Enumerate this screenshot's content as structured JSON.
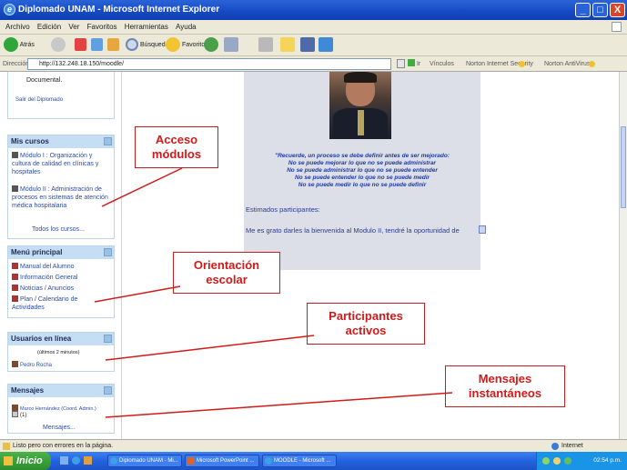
{
  "window": {
    "title": "Diplomado UNAM - Microsoft Internet Explorer",
    "minimize": "_",
    "maximize": "□",
    "close": "X"
  },
  "menubar": [
    "Archivo",
    "Edición",
    "Ver",
    "Favoritos",
    "Herramientas",
    "Ayuda"
  ],
  "toolbar": {
    "back_label": "Atrás",
    "search_label": "Búsqueda",
    "favorites_label": "Favoritos"
  },
  "address": {
    "label": "Dirección",
    "url": "http://132.248.18.150/moodle/",
    "go_label": "Ir",
    "vinculos": "Vínculos",
    "norton_security": "Norton Internet Security",
    "norton_antivirus": "Norton AntiVirus"
  },
  "sidebar": {
    "documental": "Documental.",
    "salir": "Salir del Diplomado",
    "mis_cursos": {
      "title": "Mis cursos",
      "items": [
        "Módulo I : Organización y cultura de calidad en clínicas y hospitales",
        "Módulo II : Administración de procesos en sistemas de atención médica hospitalaria"
      ],
      "all": "Todos los cursos..."
    },
    "menu_principal": {
      "title": "Menú principal",
      "items": [
        "Manual del Alumno",
        "Información General",
        "Noticias / Anuncios",
        "Plan / Calendario de Actividades"
      ]
    },
    "usuarios": {
      "title": "Usuarios en línea",
      "subtitle": "(últimos 2 minutos)",
      "user": "Pedro Rocha"
    },
    "mensajes": {
      "title": "Mensajes",
      "from": "Marco Hernández (Coord. Admin.)",
      "count": "(1)",
      "link": "Mensajes..."
    }
  },
  "content": {
    "quote_lines": [
      "\"Recuerde, un proceso se debe definir antes de ser mejorado:",
      "No se puede mejorar lo que no se puede administrar",
      "No se puede administrar lo que no se puede entender",
      "No se puede entender lo que no se puede medir",
      "No se puede medir lo que no se puede definir"
    ],
    "greeting": "Estimados participantes:",
    "body": "Me es grato  darles la bienvenida al Modulo II, tendré la oportunidad de"
  },
  "callouts": {
    "acceso": "Acceso\nmódulos",
    "orientacion": "Orientación\nescolar",
    "participantes": "Participantes\nactivos",
    "mensajes": "Mensajes\ninstantáneos"
  },
  "status": {
    "text": "Listo pero con errores en la página.",
    "zone": "Internet"
  },
  "taskbar": {
    "start": "Inicio",
    "tasks": [
      "Diplomado UNAM - Mi...",
      "Microsoft PowerPoint ...",
      "MOODLE - Microsoft ..."
    ],
    "clock": "02:54 p.m."
  },
  "colors": {
    "callout_red": "#d11a1a",
    "sidebar_header": "#c5def3",
    "link": "#2b4da0"
  }
}
